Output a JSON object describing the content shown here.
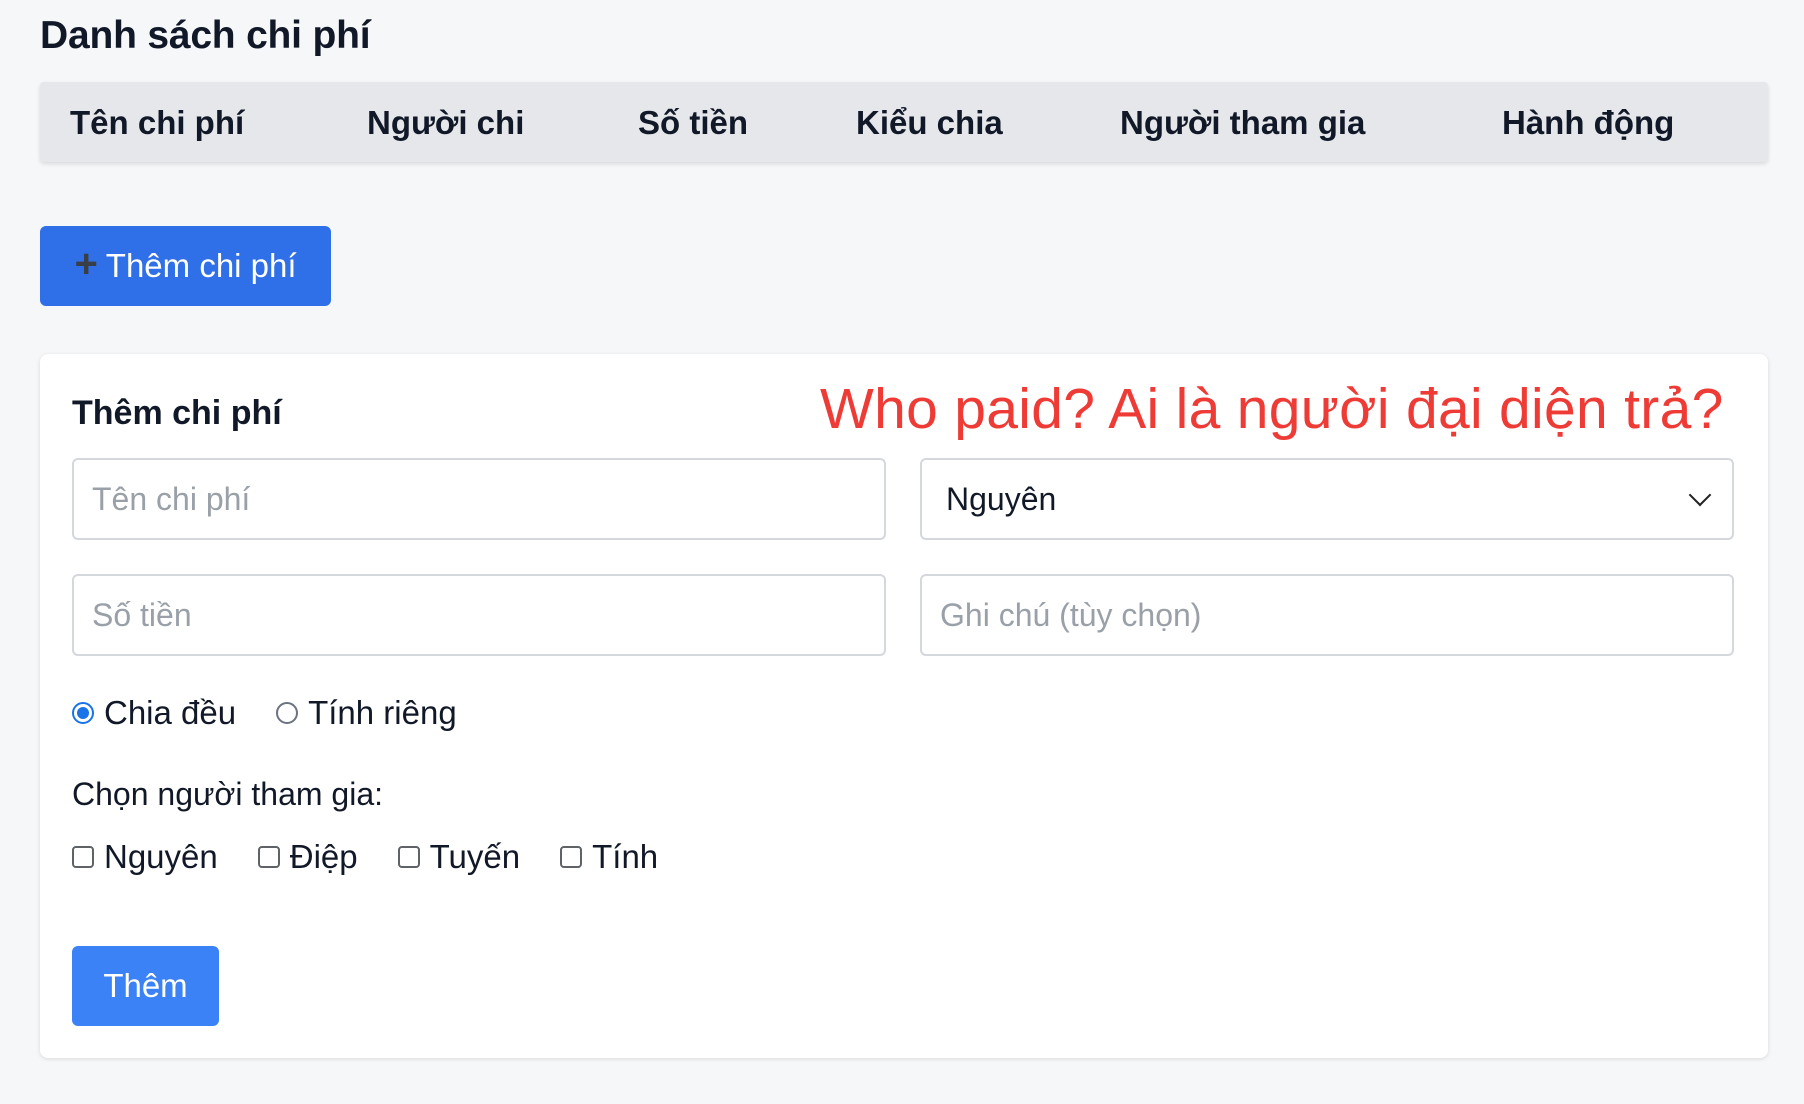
{
  "page": {
    "title": "Danh sách chi phí"
  },
  "table": {
    "headers": [
      "Tên chi phí",
      "Người chi",
      "Số tiền",
      "Kiểu chia",
      "Người tham gia",
      "Hành động"
    ]
  },
  "add_button": {
    "icon": "+",
    "label": "Thêm chi phí"
  },
  "form": {
    "title": "Thêm chi phí",
    "annotation": "Who paid? Ai là người đại diện trả?",
    "name_placeholder": "Tên chi phí",
    "payer_selected": "Nguyên",
    "amount_placeholder": "Số tiền",
    "note_placeholder": "Ghi chú (tùy chọn)",
    "split_options": [
      {
        "label": "Chia đều",
        "checked": true
      },
      {
        "label": "Tính riêng",
        "checked": false
      }
    ],
    "participants_label": "Chọn người tham gia:",
    "participants": [
      "Nguyên",
      "Điệp",
      "Tuyến",
      "Tính"
    ],
    "submit_label": "Thêm"
  },
  "colors": {
    "primary_button": "#2f6fe8",
    "submit_button": "#3b82f6",
    "annotation": "#ef3b36",
    "radio_checked": "#1a73e8"
  }
}
